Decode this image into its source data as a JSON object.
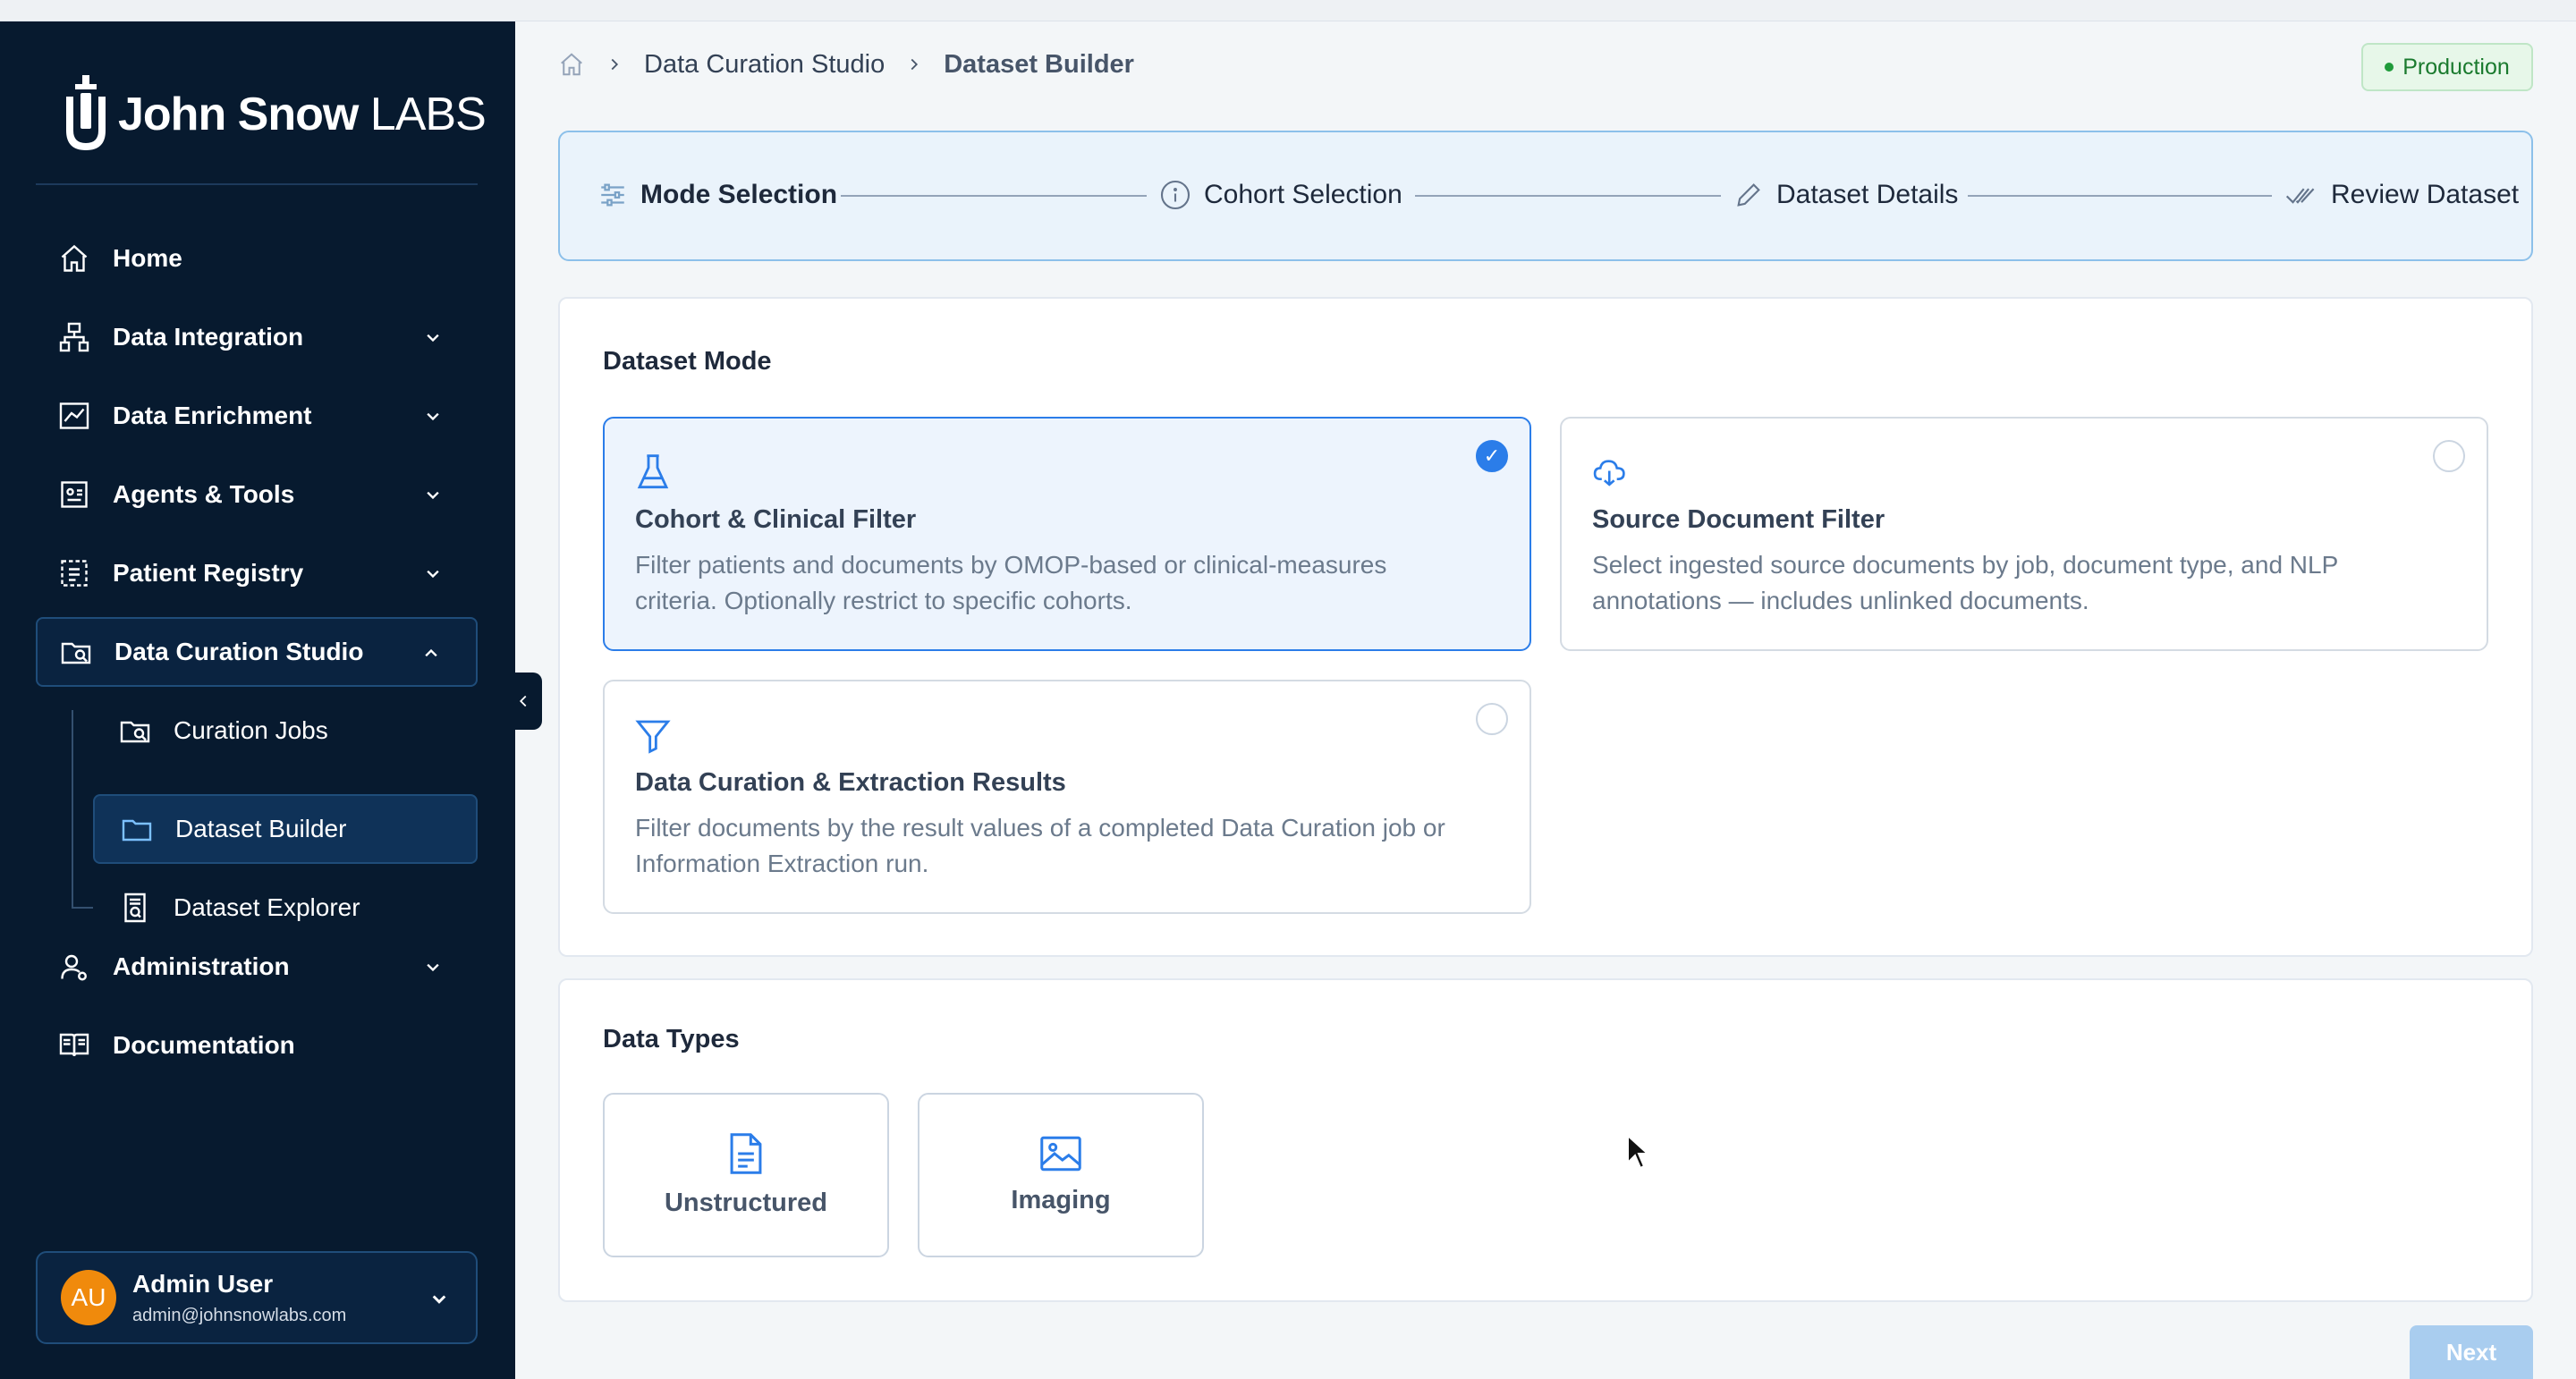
{
  "app": {
    "brand_main": "John Snow",
    "brand_suffix": "LABS",
    "environment": "Production"
  },
  "sidebar": {
    "items": [
      {
        "label": "Home",
        "icon": "home-icon"
      },
      {
        "label": "Data Integration",
        "icon": "sitemap-icon"
      },
      {
        "label": "Data Enrichment",
        "icon": "chart-icon"
      },
      {
        "label": "Agents & Tools",
        "icon": "agent-icon"
      },
      {
        "label": "Patient Registry",
        "icon": "registry-icon"
      },
      {
        "label": "Data Curation Studio",
        "icon": "folder-search-icon"
      },
      {
        "label": "Administration",
        "icon": "user-settings-icon"
      },
      {
        "label": "Documentation",
        "icon": "book-icon"
      }
    ],
    "sub_items": [
      {
        "label": "Curation Jobs",
        "icon": "folder-search-icon"
      },
      {
        "label": "Dataset Builder",
        "icon": "folder-icon"
      },
      {
        "label": "Dataset Explorer",
        "icon": "document-search-icon"
      }
    ],
    "user": {
      "initials": "AU",
      "name": "Admin User",
      "email": "admin@johnsnowlabs.com"
    }
  },
  "breadcrumb": {
    "items": [
      "Data Curation Studio",
      "Dataset Builder"
    ]
  },
  "stepper": {
    "steps": [
      {
        "label": "Mode Selection",
        "icon": "sliders-icon"
      },
      {
        "label": "Cohort Selection",
        "icon": "info-icon"
      },
      {
        "label": "Dataset Details",
        "icon": "pencil-icon"
      },
      {
        "label": "Review Dataset",
        "icon": "double-check-icon"
      }
    ],
    "current": 0
  },
  "dataset_mode": {
    "title": "Dataset Mode",
    "options": [
      {
        "title": "Cohort & Clinical Filter",
        "desc_line1": "Filter patients and documents by OMOP-based or clinical-measures",
        "desc_line2": "criteria. Optionally restrict to specific cohorts.",
        "selected": true,
        "icon": "flask-icon"
      },
      {
        "title": "Source Document Filter",
        "desc_line1": "Select ingested source documents by job, document type, and NLP",
        "desc_line2": "annotations — includes unlinked documents.",
        "selected": false,
        "icon": "cloud-download-icon"
      },
      {
        "title": "Data Curation & Extraction Results",
        "desc_line1": "Filter documents by the result values of a completed Data Curation job or",
        "desc_line2": "Information Extraction run.",
        "selected": false,
        "icon": "filter-icon"
      }
    ],
    "check_mark": "✓"
  },
  "data_types": {
    "title": "Data Types",
    "options": [
      {
        "label": "Unstructured",
        "icon": "document-icon"
      },
      {
        "label": "Imaging",
        "icon": "image-icon"
      }
    ]
  },
  "actions": {
    "next_label": "Next"
  },
  "colors": {
    "sidebar_bg": "#071a2f",
    "accent": "#2b7de9",
    "selected_card_bg": "#edf4fd",
    "production_green": "#1a7a2e"
  }
}
